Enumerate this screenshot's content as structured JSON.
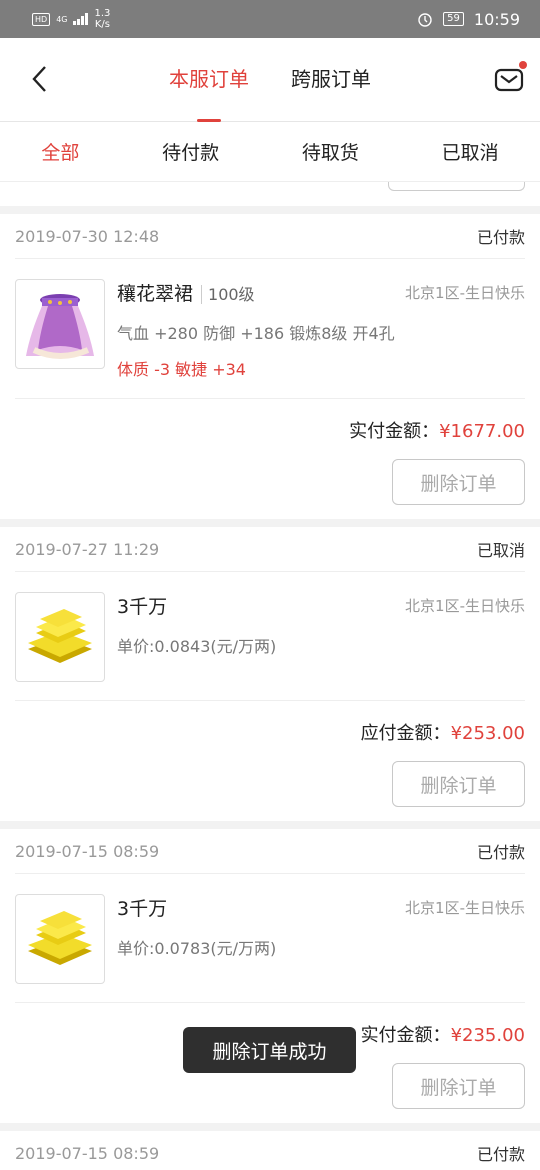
{
  "status_bar": {
    "hd": "HD",
    "network": "4G",
    "speed_value": "1.3",
    "speed_unit": "K/s",
    "battery": "59",
    "time": "10:59"
  },
  "header": {
    "tab_local": "本服订单",
    "tab_cross": "跨服订单"
  },
  "filters": [
    "全部",
    "待付款",
    "待取货",
    "已取消"
  ],
  "orders": [
    {
      "date": "2019-07-30 12:48",
      "status": "已付款",
      "name": "穰花翠裙",
      "level": "100级",
      "server": "北京1区-生日快乐",
      "attr": "气血 +280 防御 +186 锻炼8级 开4孔",
      "attr_red": "体质 -3 敏捷 +34",
      "total_label": "实付金额：",
      "total_amount": "¥1677.00",
      "delete_label": "删除订单",
      "icon": "skirt-icon"
    },
    {
      "date": "2019-07-27 11:29",
      "status": "已取消",
      "name": "3千万",
      "server": "北京1区-生日快乐",
      "attr": "单价:0.0843(元/万两)",
      "total_label": "应付金额：",
      "total_amount": "¥253.00",
      "delete_label": "删除订单",
      "icon": "gold-bars-icon"
    },
    {
      "date": "2019-07-15 08:59",
      "status": "已付款",
      "name": "3千万",
      "server": "北京1区-生日快乐",
      "attr": "单价:0.0783(元/万两)",
      "total_label": "实付金额：",
      "total_amount": "¥235.00",
      "delete_label": "删除订单",
      "icon": "gold-bars-icon"
    },
    {
      "date": "2019-07-15 08:59",
      "status": "已付款"
    }
  ],
  "toast": "删除订单成功",
  "colors": {
    "accent": "#e0423c",
    "status_bar": "#7d7d7d"
  }
}
